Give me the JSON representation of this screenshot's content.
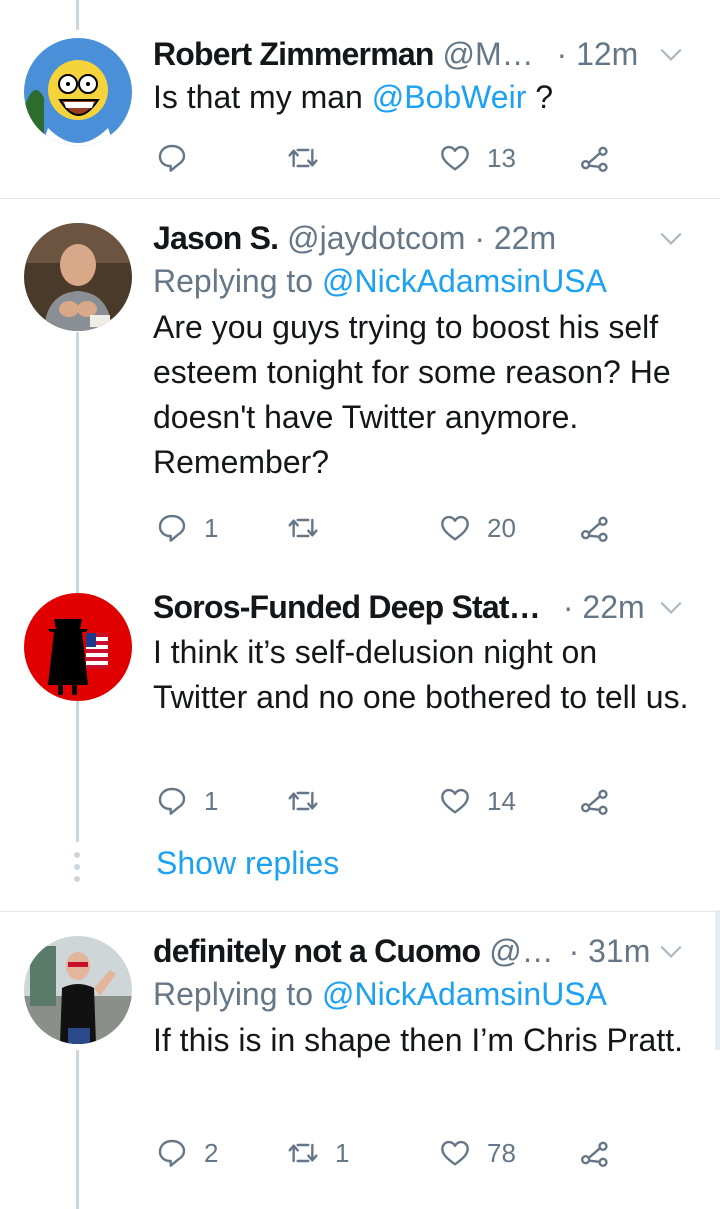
{
  "colors": {
    "link": "#1da1f2",
    "secondary_text": "#657786",
    "primary_text": "#14171a",
    "thread_line": "#ccd6dd",
    "separator": "#e1e8ed"
  },
  "tweets": [
    {
      "name": "Robert Zimmerman",
      "handle": "@M…",
      "time": "· 12m",
      "replying_label": "",
      "replying_to": "",
      "text_before": "Is that my man ",
      "text_mention": "@BobWeir",
      "text_after": " ?",
      "reply_count": "",
      "retweet_count": "",
      "like_count": "13",
      "avatar": "homer-cartoon-avatar"
    },
    {
      "name": "Jason S.",
      "handle": "@jaydotcom",
      "time": "· 22m",
      "replying_label": "Replying to ",
      "replying_to": "@NickAdamsinUSA",
      "text": "Are you guys trying to boost his self esteem tonight for some reason? He doesn't have Twitter anymore. Remember?",
      "reply_count": "1",
      "retweet_count": "",
      "like_count": "20",
      "avatar": "man-photo-avatar"
    },
    {
      "name": "Soros-Funded Deep Stat…",
      "handle": "",
      "time": "· 22m",
      "text": "I think it’s self-delusion night on Twitter and no one bothered to tell us.",
      "reply_count": "1",
      "retweet_count": "",
      "like_count": "14",
      "avatar": "spy-flag-avatar"
    },
    {
      "name": "definitely not a Cuomo",
      "handle": "@…",
      "time": "· 31m",
      "replying_label": "Replying to ",
      "replying_to": "@NickAdamsinUSA",
      "text": "If this is in shape then I’m Chris Pratt.",
      "reply_count": "2",
      "retweet_count": "1",
      "like_count": "78",
      "avatar": "gym-photo-avatar"
    }
  ],
  "show_replies": "Show replies",
  "icons": {
    "reply": "reply-icon",
    "retweet": "retweet-icon",
    "like": "heart-icon",
    "share": "share-icon",
    "caret": "chevron-down-icon"
  }
}
